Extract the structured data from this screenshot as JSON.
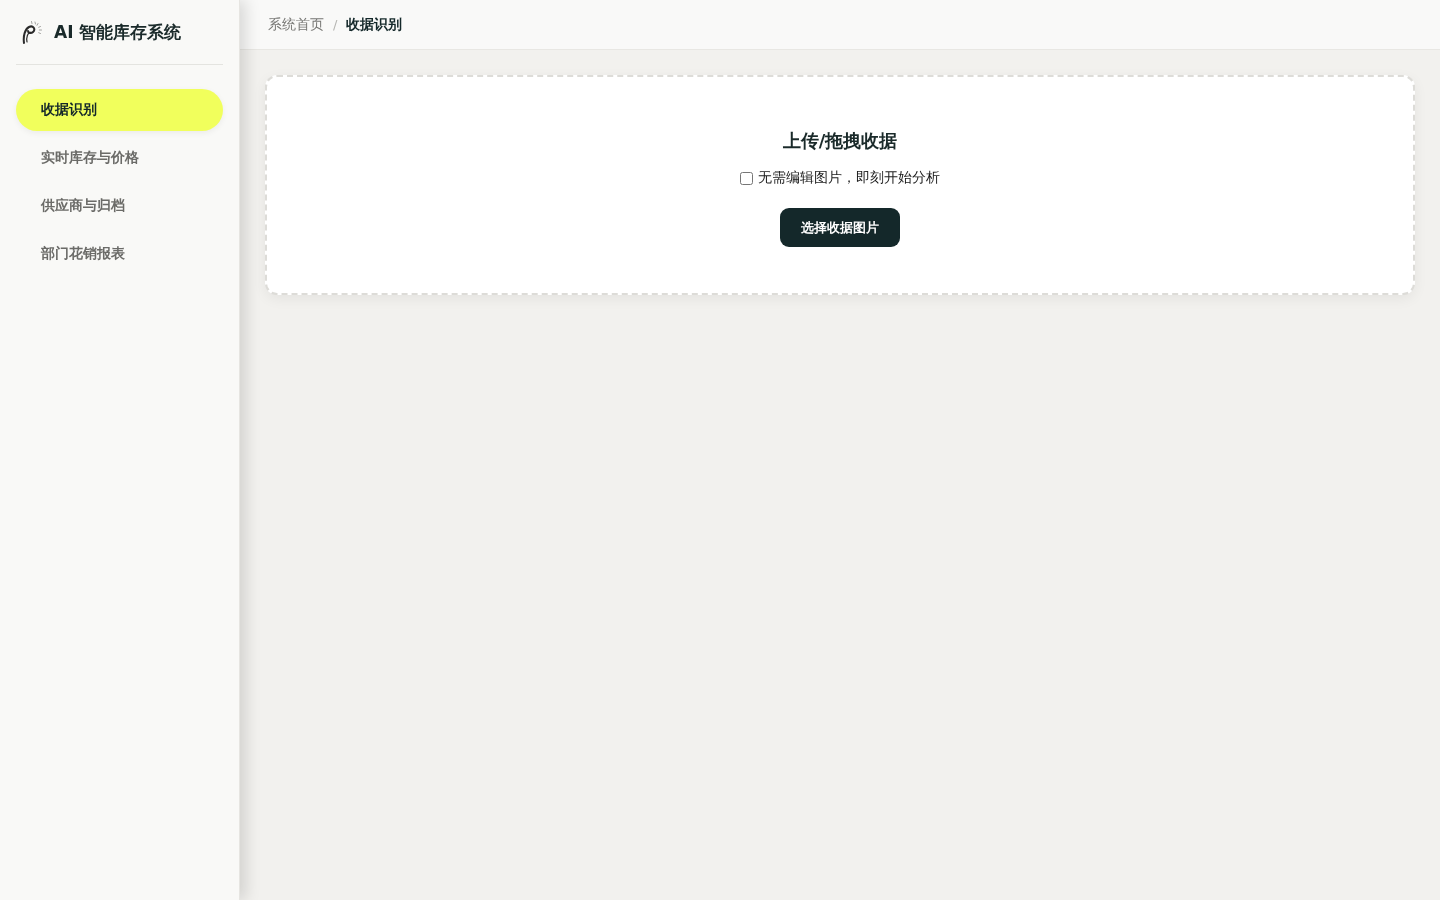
{
  "sidebar": {
    "title": "AI 智能库存系统",
    "items": [
      {
        "label": "收据识别",
        "selected": true
      },
      {
        "label": "实时库存与价格",
        "selected": false
      },
      {
        "label": "供应商与归档",
        "selected": false
      },
      {
        "label": "部门花销报表",
        "selected": false
      }
    ]
  },
  "breadcrumb": {
    "separator": "/",
    "items": [
      {
        "label": "系统首页",
        "current": false
      },
      {
        "label": "收据识别",
        "current": true
      }
    ]
  },
  "upload": {
    "title": "上传/拖拽收据",
    "option": {
      "label": "无需编辑图片，即刻开始分析",
      "checked": false
    },
    "button": "选择收据图片"
  }
}
